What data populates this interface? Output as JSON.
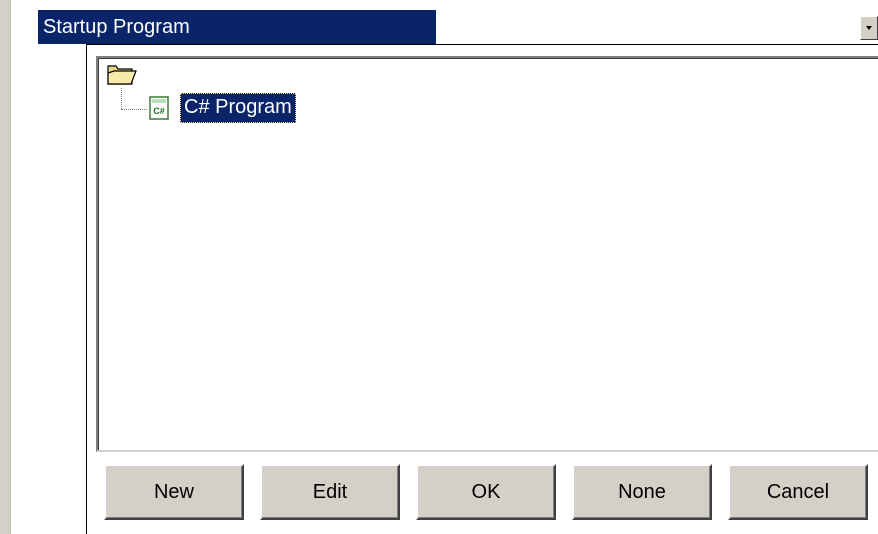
{
  "property": {
    "name": "Startup Program",
    "value": ""
  },
  "tree": {
    "root_icon": "folder-icon",
    "child": {
      "icon": "csharp-file-icon",
      "label": "C# Program"
    }
  },
  "buttons": {
    "new": "New",
    "edit": "Edit",
    "ok": "OK",
    "none": "None",
    "cancel": "Cancel"
  },
  "colors": {
    "selection": "#0a246a",
    "face": "#d4d0c8"
  }
}
